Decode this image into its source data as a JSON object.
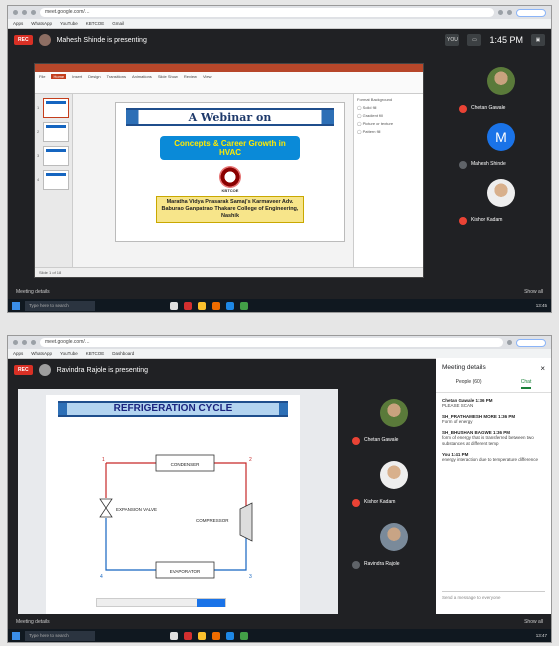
{
  "shot1": {
    "address": "meet.google.com/…",
    "presenter_text": "Mahesh Shinde is presenting",
    "rec_label": "REC",
    "top_right_badge": "YOU MEETING… and 79 more",
    "time": "1:45 PM",
    "ppt_tabs": [
      "File",
      "Home",
      "Insert",
      "Design",
      "Transitions",
      "Animations",
      "Slide Show",
      "Review",
      "View"
    ],
    "slide": {
      "heading": "A Webinar on",
      "topic": "Concepts & Career Growth in HVAC",
      "logo_caption": "KBTCOE",
      "college": "Maratha Vidya Prasarak Samaj's Karmaveer Adv. Baburao Ganpatrao Thakare College of Engineering, Nashik"
    },
    "participants": [
      {
        "name": "Chetan Gawale",
        "initial": "",
        "mic_off": true
      },
      {
        "name": "Mahesh Shinde",
        "initial": "M",
        "mic_off": false
      },
      {
        "name": "Kishor Kadam",
        "initial": "",
        "mic_off": true
      }
    ],
    "footer_left": "Meeting details",
    "footer_right": "Show all",
    "taskbar_search": "Type here to search",
    "clock": "13:45"
  },
  "shot2": {
    "address": "meet.google.com/…",
    "presenter_text": "Ravindra Rajole is presenting",
    "rec_label": "REC",
    "slide_title": "REFRIGERATION CYCLE",
    "diagram": {
      "top": "CONDENSER",
      "left": "EXPANSION VALVE",
      "right": "COMPRESSOR",
      "bottom": "EVAPORATOR",
      "corners": [
        "1",
        "2",
        "3",
        "4"
      ]
    },
    "participants": [
      {
        "name": "Chetan Gawale"
      },
      {
        "name": "Kishor Kadam"
      },
      {
        "name": "Ravindra Rajole"
      }
    ],
    "details": {
      "title": "Meeting details",
      "tab_people": "People (60)",
      "tab_chat": "Chat",
      "messages": [
        {
          "who": "Chetan Gawale 1:36 PM",
          "text": "PLEASE SCAN"
        },
        {
          "who": "SH_PRATHAMESH MORE 1:36 PM",
          "text": "Form of energy"
        },
        {
          "who": "SH_BHUSHAN BAGWE 1:36 PM",
          "text": "form of energy that is transferred between two substances at different temp"
        },
        {
          "who": "You 1:41 PM",
          "text": "energy interaction due to temperature difference"
        }
      ],
      "send_placeholder": "Send a message to everyone"
    },
    "footer_left": "Meeting details",
    "footer_right": "Show all",
    "taskbar_search": "Type here to search",
    "clock": "13:47"
  },
  "colors": {
    "rec": "#d93025",
    "meet_dark": "#202124",
    "chat_green": "#188038",
    "slide_blue": "#0a8ad8"
  }
}
